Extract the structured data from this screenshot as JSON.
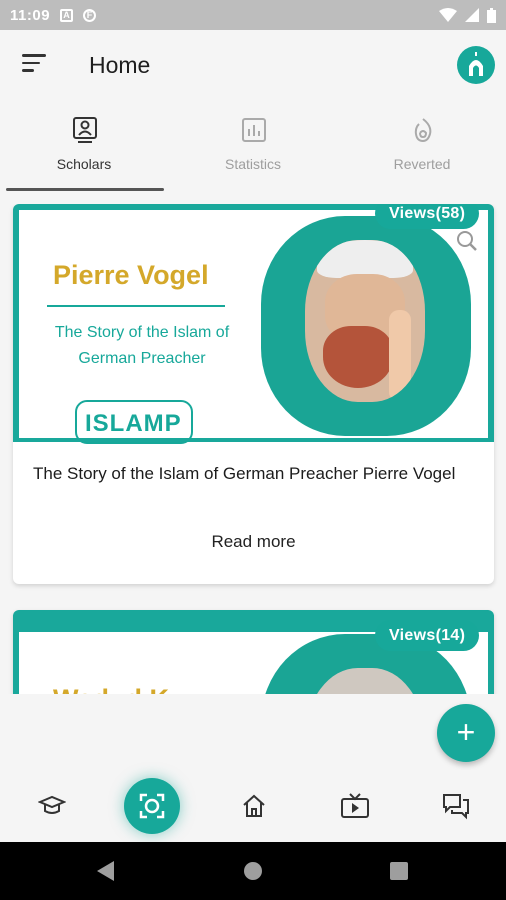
{
  "status_bar": {
    "time": "11:09",
    "notif_a": "A",
    "notif_b": "F"
  },
  "app_bar": {
    "title": "Home"
  },
  "tabs": [
    {
      "label": "Scholars",
      "icon": "scholar-icon",
      "active": true
    },
    {
      "label": "Statistics",
      "icon": "statistics-icon",
      "active": false
    },
    {
      "label": "Reverted",
      "icon": "reverted-icon",
      "active": false
    }
  ],
  "cards": [
    {
      "views": "Views(58)",
      "banner_name": "Pierre Vogel",
      "banner_subtitle": "The Story of the Islam of German Preacher",
      "banner_logo": "ISLAMP",
      "description": "The Story of the Islam of German Preacher Pierre Vogel",
      "read_more": "Read more"
    },
    {
      "views": "Views(14)",
      "banner_name": "Wadud K..."
    }
  ],
  "fab": {
    "label": "+"
  },
  "bottom_nav": [
    "education-icon",
    "scan-icon",
    "home-icon",
    "video-icon",
    "chat-icon"
  ],
  "colors": {
    "accent": "#17a89a",
    "gold": "#d4a82a"
  }
}
